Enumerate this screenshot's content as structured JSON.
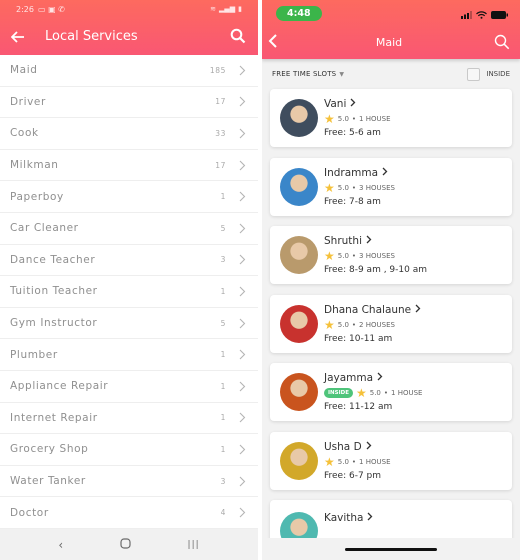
{
  "left_screen": {
    "status_bar": {
      "time": "2:26"
    },
    "header": {
      "title": "Local Services",
      "back_icon": "arrow-left-icon",
      "search_icon": "search-icon"
    },
    "services": [
      {
        "name": "Maid",
        "count": "185"
      },
      {
        "name": "Driver",
        "count": "17"
      },
      {
        "name": "Cook",
        "count": "33"
      },
      {
        "name": "Milkman",
        "count": "17"
      },
      {
        "name": "Paperboy",
        "count": "1"
      },
      {
        "name": "Car Cleaner",
        "count": "5"
      },
      {
        "name": "Dance Teacher",
        "count": "3"
      },
      {
        "name": "Tuition Teacher",
        "count": "1"
      },
      {
        "name": "Gym Instructor",
        "count": "5"
      },
      {
        "name": "Plumber",
        "count": "1"
      },
      {
        "name": "Appliance Repair",
        "count": "1"
      },
      {
        "name": "Internet Repair",
        "count": "1"
      },
      {
        "name": "Grocery Shop",
        "count": "1"
      },
      {
        "name": "Water Tanker",
        "count": "3"
      },
      {
        "name": "Doctor",
        "count": "4"
      }
    ],
    "nav": {
      "back": "‹",
      "home": "○",
      "recents": "|||"
    }
  },
  "right_screen": {
    "status_bar": {
      "time": "4:48"
    },
    "header": {
      "title": "Maid",
      "back_icon": "chevron-left-icon",
      "search_icon": "search-icon"
    },
    "filter": {
      "label": "FREE TIME SLOTS",
      "inside_label": "INSIDE",
      "inside_checked": false
    },
    "providers": [
      {
        "name": "Vani",
        "rating": "5.0",
        "houses": "1 HOUSE",
        "free": "Free: 5-6 am",
        "inside": false,
        "avatar_color": "#3f4d5e"
      },
      {
        "name": "Indramma",
        "rating": "5.0",
        "houses": "3 HOUSES",
        "free": "Free: 7-8 am",
        "inside": false,
        "avatar_color": "#3a86c9"
      },
      {
        "name": "Shruthi",
        "rating": "5.0",
        "houses": "3 HOUSES",
        "free": "Free: 8-9 am , 9-10 am",
        "inside": false,
        "avatar_color": "#b99a6c"
      },
      {
        "name": "Dhana Chalaune",
        "rating": "5.0",
        "houses": "2 HOUSES",
        "free": "Free: 10-11 am",
        "inside": false,
        "avatar_color": "#c8322e"
      },
      {
        "name": "Jayamma",
        "rating": "5.0",
        "houses": "1 HOUSE",
        "free": "Free: 11-12 am",
        "inside": true,
        "inside_label": "INSIDE",
        "avatar_color": "#c9541e"
      },
      {
        "name": "Usha D",
        "rating": "5.0",
        "houses": "1 HOUSE",
        "free": "Free: 6-7 pm",
        "inside": false,
        "avatar_color": "#d2a82a"
      },
      {
        "name": "Kavitha",
        "rating": "",
        "houses": "",
        "free": "",
        "inside": false,
        "avatar_color": "#4fb9b0"
      }
    ]
  },
  "colors": {
    "header_top": "#fd6a5f",
    "header_bottom": "#f95773",
    "time_pill": "#3bb54a",
    "inside_badge": "#4ec47a",
    "star": "#f5c13a"
  }
}
